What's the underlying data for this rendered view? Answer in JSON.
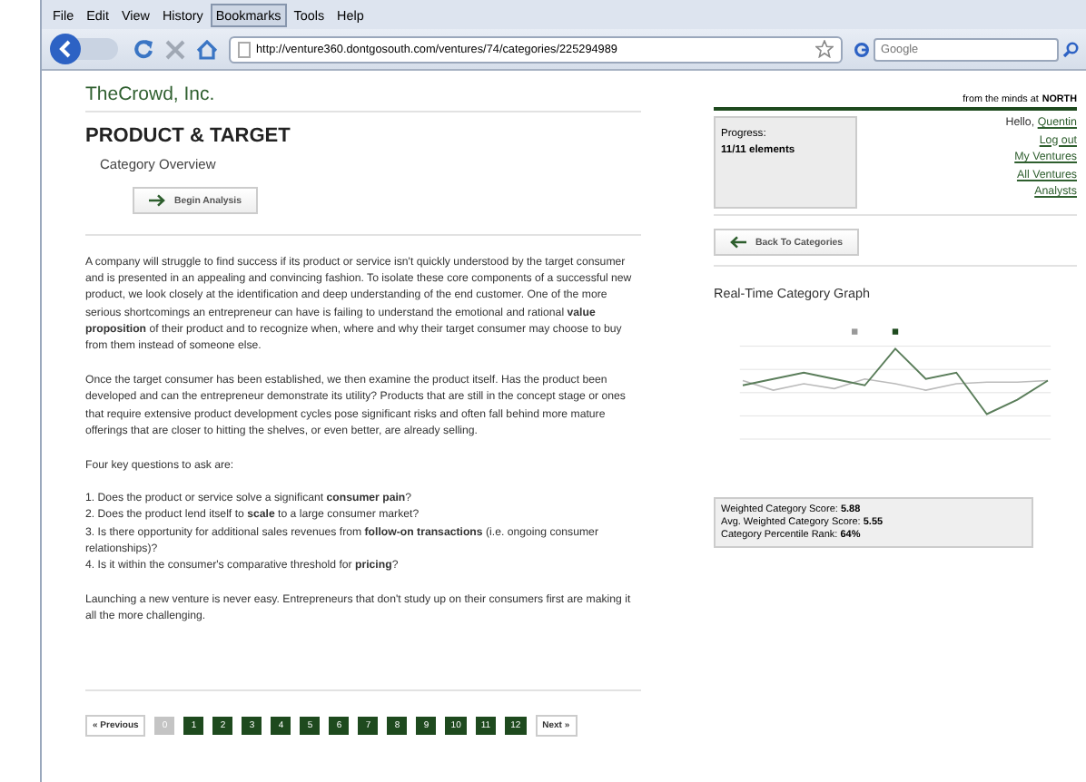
{
  "browser": {
    "menu": [
      {
        "label": "File",
        "selected": false
      },
      {
        "label": "Edit",
        "selected": false
      },
      {
        "label": "View",
        "selected": false
      },
      {
        "label": "History",
        "selected": false
      },
      {
        "label": "Bookmarks",
        "selected": true
      },
      {
        "label": "Tools",
        "selected": false
      },
      {
        "label": "Help",
        "selected": false
      }
    ],
    "url": "http://venture360.dontgosouth.com/ventures/74/categories/225294989",
    "search": {
      "placeholder": "Google"
    }
  },
  "site": {
    "company": "TheCrowd, Inc.",
    "tagline": "from the minds at",
    "brand": "NORTH"
  },
  "page": {
    "title": "PRODUCT & TARGET",
    "subtitle": "Category Overview",
    "begin_button": "Begin Analysis",
    "paragraphs": [
      {
        "kind": "text",
        "text": "A company will struggle to find success if its product or service isn't quickly understood by the target consumer and is presented in an appealing and convincing fashion. To isolate these core components of a successful new product, we look closely at the identification and deep understanding of the end customer. One of the more serious shortcomings an entrepreneur can have is failing to understand the emotional and rational **value proposition** of their product and to recognize when, where and why their target consumer may choose to buy from them instead of someone else."
      },
      {
        "kind": "text",
        "text": "Once the target consumer has been established, we then examine the product itself. Has the product been developed and can the entrepreneur demonstrate its utility? Products that are still in the concept stage or ones that require extensive product development cycles pose significant risks and often fall behind more mature offerings that are closer to hitting the shelves, or even better, are already selling."
      },
      {
        "kind": "text",
        "text": "Four key questions to ask are:"
      },
      {
        "kind": "list",
        "items": [
          "1. Does the product or service solve a significant **consumer pain**?",
          "2. Does the product lend itself to **scale** to a large consumer market?",
          "3. Is there opportunity for additional sales revenues from **follow-on transactions** (i.e. ongoing consumer relationships)?",
          "4. Is it within the consumer's comparative threshold for **pricing**?"
        ]
      },
      {
        "kind": "text",
        "text": "Launching a new venture is never easy. Entrepreneurs that don't study up on their consumers first are making it all the more challenging."
      }
    ],
    "pagination": {
      "previous": "« Previous",
      "next": "Next »",
      "pages": [
        {
          "label": "0",
          "selected": true
        },
        {
          "label": "1",
          "selected": false
        },
        {
          "label": "2",
          "selected": false
        },
        {
          "label": "3",
          "selected": false
        },
        {
          "label": "4",
          "selected": false
        },
        {
          "label": "5",
          "selected": false
        },
        {
          "label": "6",
          "selected": false
        },
        {
          "label": "7",
          "selected": false
        },
        {
          "label": "8",
          "selected": false
        },
        {
          "label": "9",
          "selected": false
        },
        {
          "label": "10",
          "selected": false
        },
        {
          "label": "11",
          "selected": false
        },
        {
          "label": "12",
          "selected": false
        }
      ]
    }
  },
  "sidebar": {
    "progress_label": "Progress:",
    "progress_value": "11/11 elements",
    "greeting": "Hello,",
    "user": "Quentin",
    "links": [
      "Log out",
      "My Ventures",
      "All Ventures",
      "Analysts"
    ],
    "back_button": "Back To Categories",
    "graph_title": "Real-Time Category Graph",
    "scores": [
      {
        "label": "Weighted Category Score:",
        "value": "5.88"
      },
      {
        "label": "Avg. Weighted Category Score:",
        "value": "5.55"
      },
      {
        "label": "Category Percentile Rank:",
        "value": "64%"
      }
    ]
  }
}
